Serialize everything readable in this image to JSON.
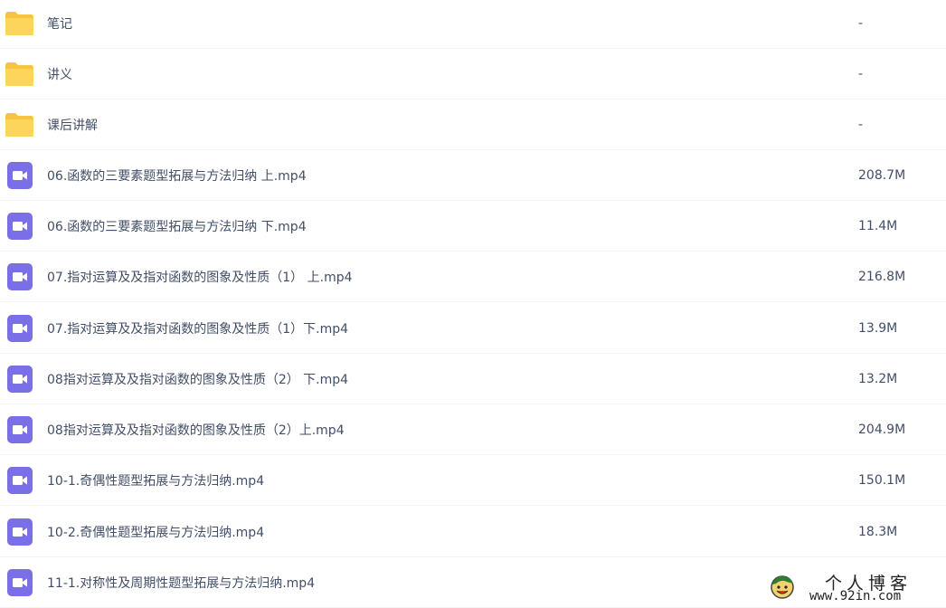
{
  "colors": {
    "folder": "#fdd55a",
    "folder_tab": "#f6c443",
    "video": "#7b6fe8",
    "text": "#424e67",
    "divider": "#f3f4f7"
  },
  "files": [
    {
      "type": "folder",
      "icon": "folder-icon",
      "name": "笔记",
      "size": "-"
    },
    {
      "type": "folder",
      "icon": "folder-icon",
      "name": "讲义",
      "size": "-"
    },
    {
      "type": "folder",
      "icon": "folder-icon",
      "name": "课后讲解",
      "size": "-"
    },
    {
      "type": "video",
      "icon": "video-file-icon",
      "name": "06.函数的三要素题型拓展与方法归纳 上.mp4",
      "size": "208.7M"
    },
    {
      "type": "video",
      "icon": "video-file-icon",
      "name": "06.函数的三要素题型拓展与方法归纳 下.mp4",
      "size": "11.4M"
    },
    {
      "type": "video",
      "icon": "video-file-icon",
      "name": "07.指对运算及及指对函数的图象及性质（1） 上.mp4",
      "size": "216.8M"
    },
    {
      "type": "video",
      "icon": "video-file-icon",
      "name": "07.指对运算及及指对函数的图象及性质（1）下.mp4",
      "size": "13.9M"
    },
    {
      "type": "video",
      "icon": "video-file-icon",
      "name": "08指对运算及及指对函数的图象及性质（2） 下.mp4",
      "size": "13.2M"
    },
    {
      "type": "video",
      "icon": "video-file-icon",
      "name": "08指对运算及及指对函数的图象及性质（2）上.mp4",
      "size": "204.9M"
    },
    {
      "type": "video",
      "icon": "video-file-icon",
      "name": "10-1.奇偶性题型拓展与方法归纳.mp4",
      "size": "150.1M"
    },
    {
      "type": "video",
      "icon": "video-file-icon",
      "name": "10-2.奇偶性题型拓展与方法归纳.mp4",
      "size": "18.3M"
    },
    {
      "type": "video",
      "icon": "video-file-icon",
      "name": "11-1.对称性及周期性题型拓展与方法归纳.mp4",
      "size": ""
    }
  ],
  "watermark": {
    "title": "个人博客",
    "url": "www.92in.com"
  }
}
